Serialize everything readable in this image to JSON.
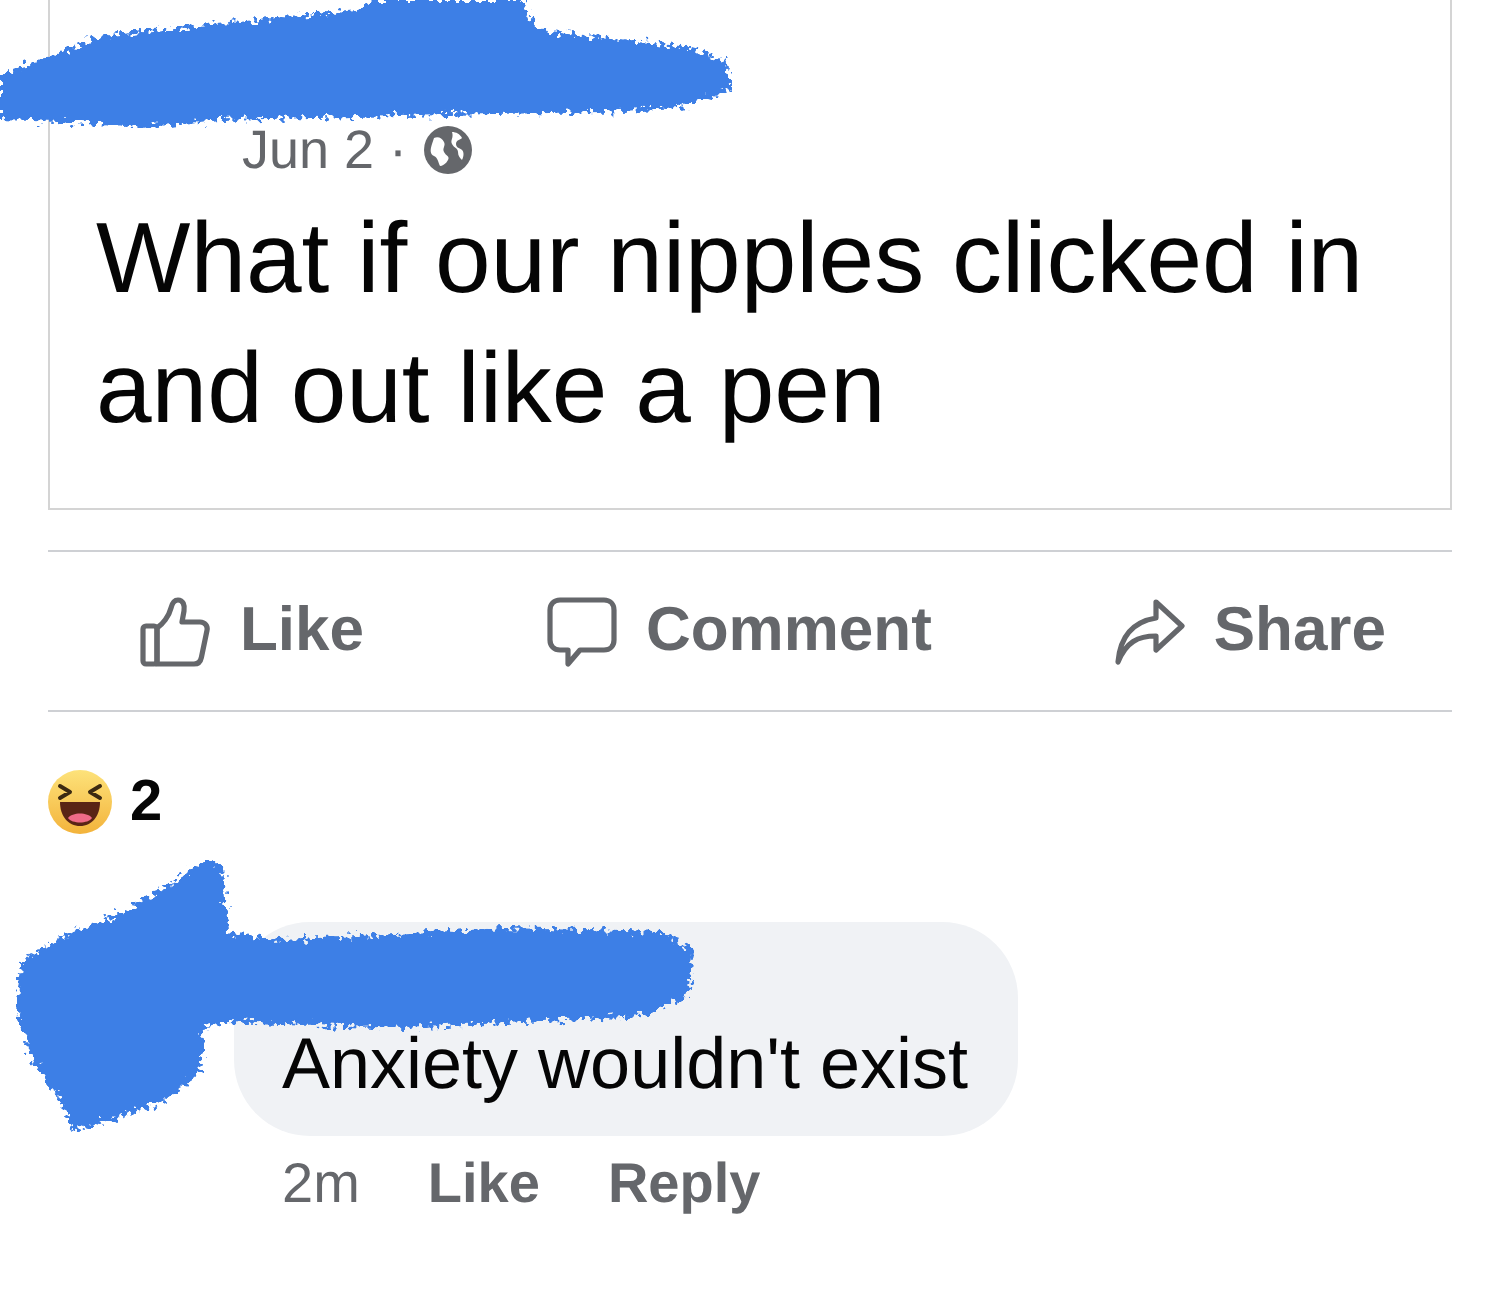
{
  "post": {
    "date": "Jun 2 ·",
    "text": "What if our nipples clicked in and out like a pen"
  },
  "actions": [
    {
      "label": "Like",
      "kind": "like"
    },
    {
      "label": "Comment",
      "kind": "comment"
    },
    {
      "label": "Share",
      "kind": "share"
    }
  ],
  "reactions": {
    "count": "2"
  },
  "comments": [
    {
      "text": "Anxiety wouldn't exist",
      "time": "2m",
      "actions": [
        "Like",
        "Reply"
      ]
    }
  ]
}
